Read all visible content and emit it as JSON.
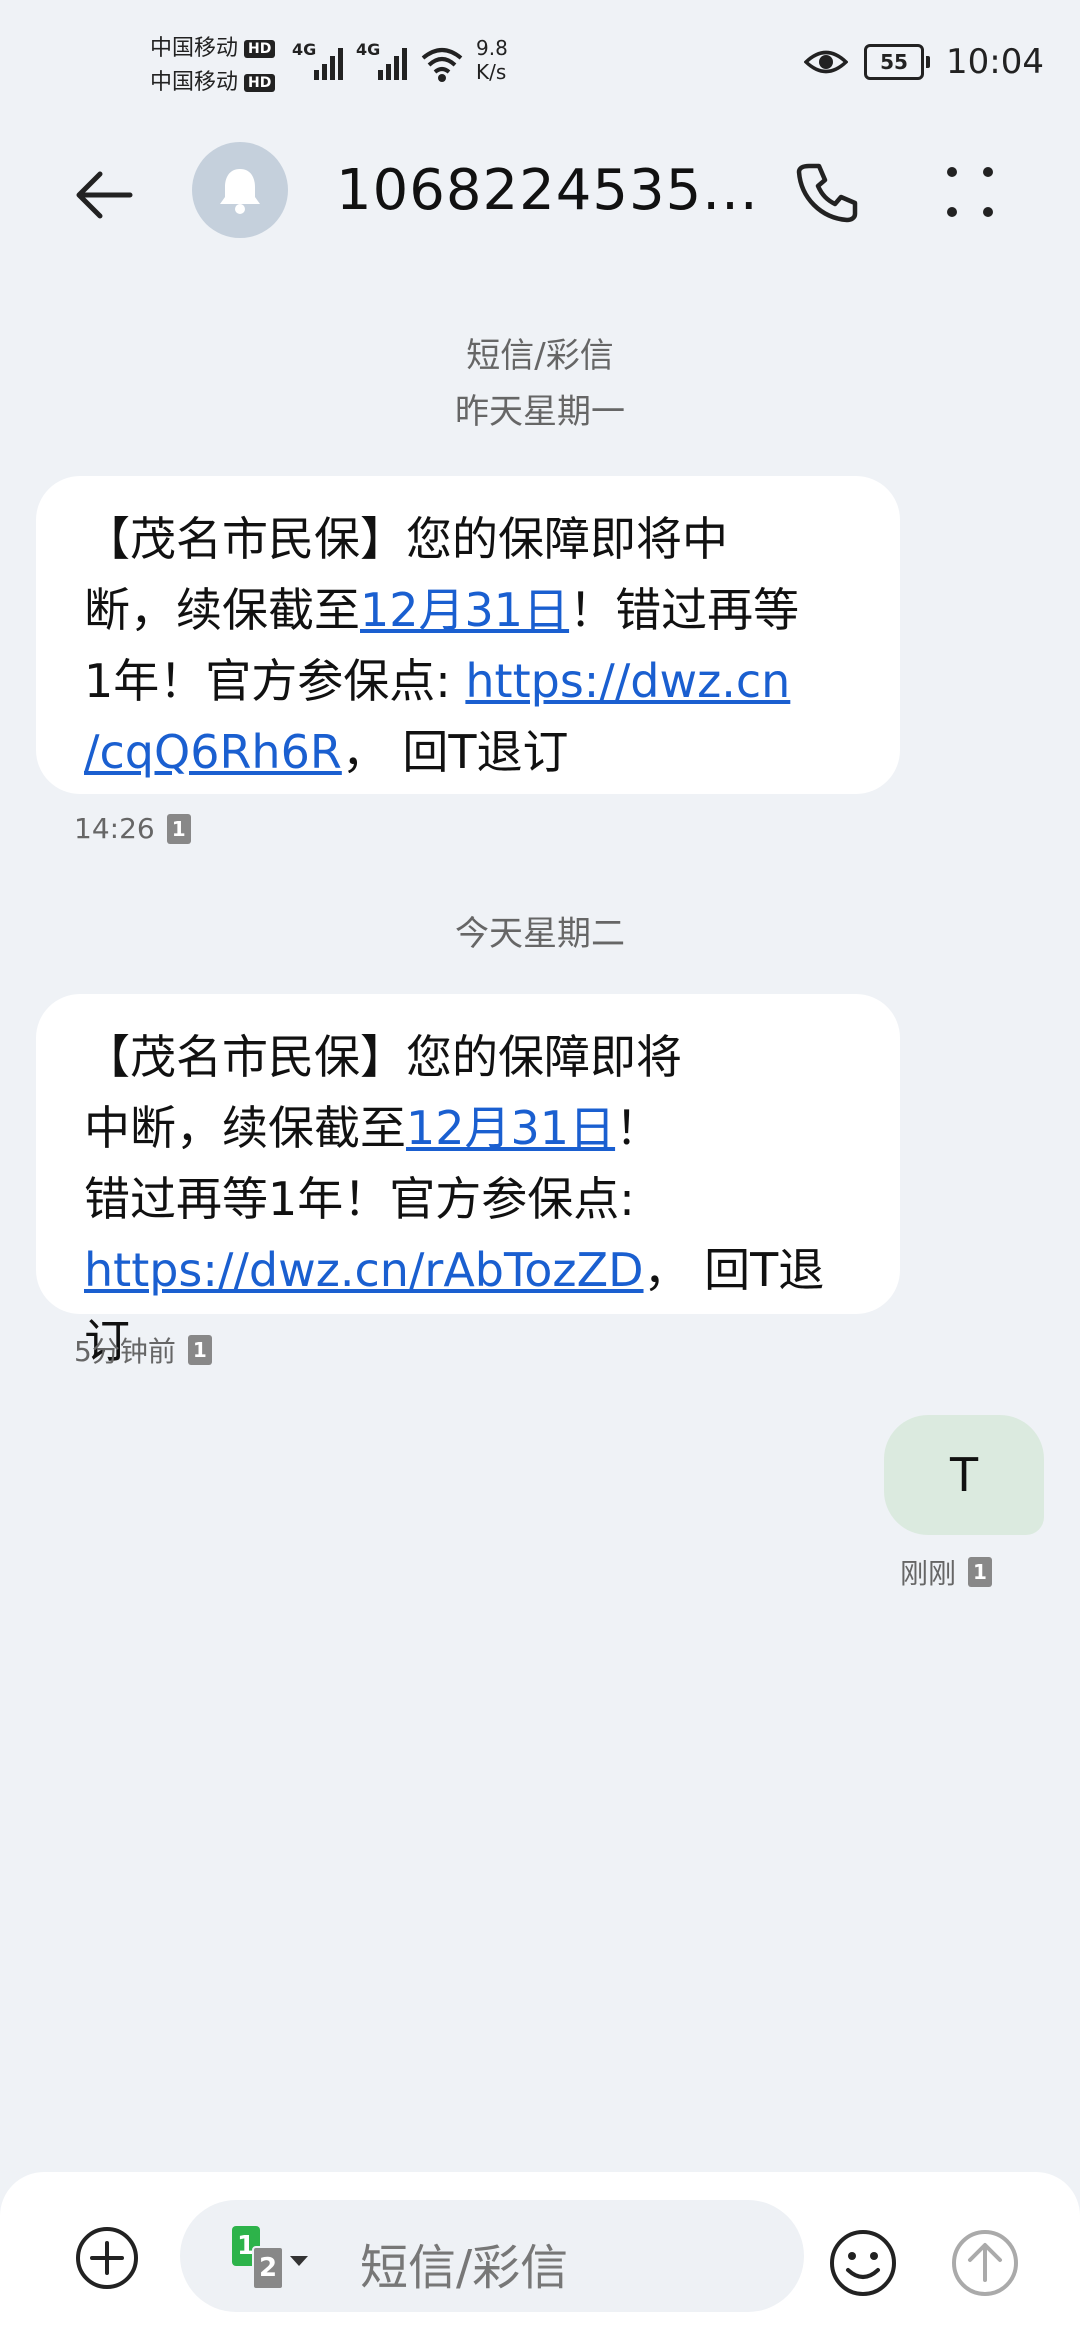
{
  "status_bar": {
    "carrier_1": "中国移动",
    "carrier_2": "中国移动",
    "hd_badge": "HD",
    "network_1": "4G",
    "network_2": "4G",
    "net_speed_value": "9.8",
    "net_speed_unit": "K/s",
    "battery": "55",
    "time": "10:04"
  },
  "header": {
    "contact": "1068224535...",
    "icons": [
      "back-arrow-icon",
      "bell-icon",
      "phone-icon",
      "more-icon"
    ]
  },
  "conversation": {
    "type_label": "短信/彩信",
    "day_1": "昨天星期一",
    "message_1": {
      "line1": "【茂名市民保】您的保障即将中",
      "line2_pre": "断，续保截至",
      "line2_link": "12月31日",
      "line2_post": "！错过再等",
      "line3_pre": "1年！官方参保点: ",
      "line3_link": "https://dwz.cn",
      "line4_link": "/cqQ6Rh6R",
      "line4_post": "， 回T退订",
      "time": "14:26",
      "sim": "1"
    },
    "day_2": "今天星期二",
    "message_2": {
      "line1": "【茂名市民保】您的保障即将",
      "line2_pre": "中断，续保截至",
      "line2_link": "12月31日",
      "line2_post": "！",
      "line3": "错过再等1年！官方参保点:",
      "line4_link": "https://dwz.cn/rAbTozZD",
      "line4_post": "， 回T退订",
      "time": "5分钟前",
      "sim": "1"
    },
    "message_3": {
      "text": "T",
      "time": "刚刚",
      "sim": "1"
    }
  },
  "composer": {
    "placeholder": "短信/彩信",
    "sim_primary": "1",
    "sim_secondary": "2"
  }
}
